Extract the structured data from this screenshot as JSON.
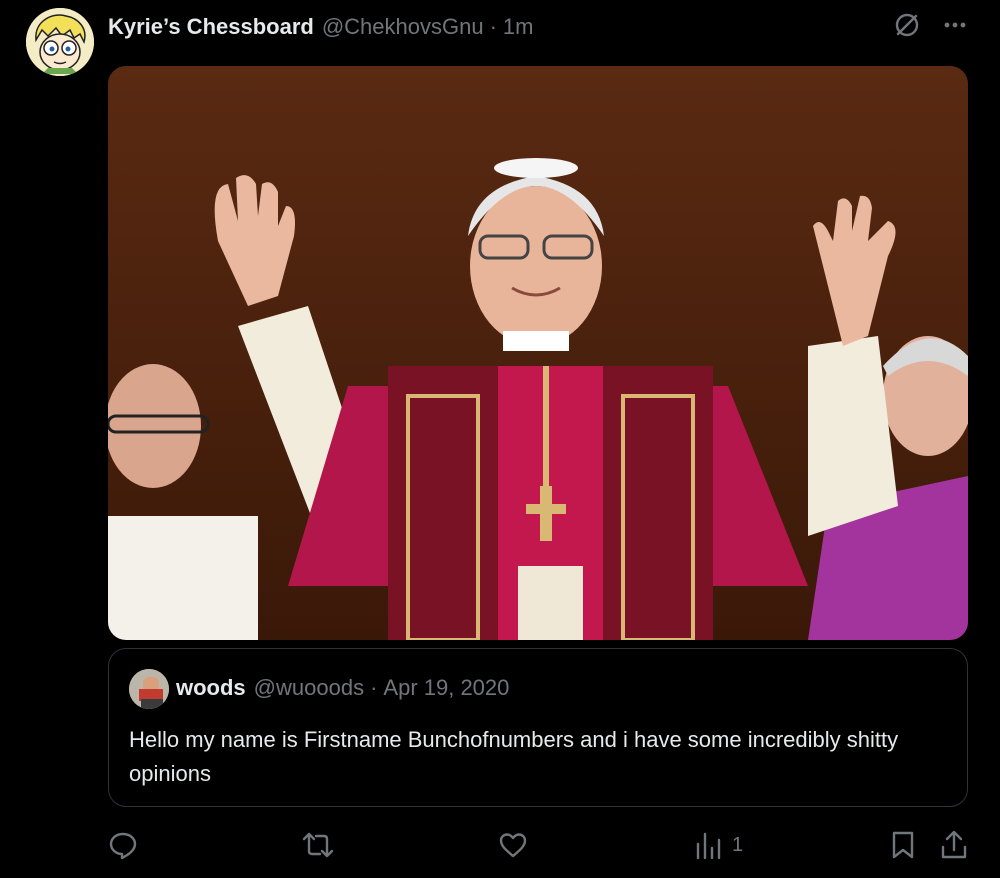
{
  "post": {
    "display_name": "Kyrie’s Chessboard",
    "handle": "@ChekhovsGnu",
    "separator": "·",
    "time": "1m",
    "avatar_icon": "cartoon-avatar-icon"
  },
  "top_icons": [
    "grok-icon",
    "more-icon"
  ],
  "media": {
    "subject": "photo-of-pope-waving-on-balcony"
  },
  "quoted": {
    "display_name": "woods",
    "handle": "@wuooods",
    "separator": "·",
    "date": "Apr 19, 2020",
    "text": "Hello my name is Firstname Bunchofnumbers and i have some incredibly shitty opinions"
  },
  "actions": {
    "reply_icon": "reply-icon",
    "retweet_icon": "retweet-icon",
    "like_icon": "like-icon",
    "views_icon": "views-icon",
    "views_count": "1",
    "bookmark_icon": "bookmark-icon",
    "share_icon": "share-icon"
  },
  "colors": {
    "background": "#000000",
    "text": "#e7e9ea",
    "secondary": "#71767b",
    "border": "#2f3336"
  }
}
